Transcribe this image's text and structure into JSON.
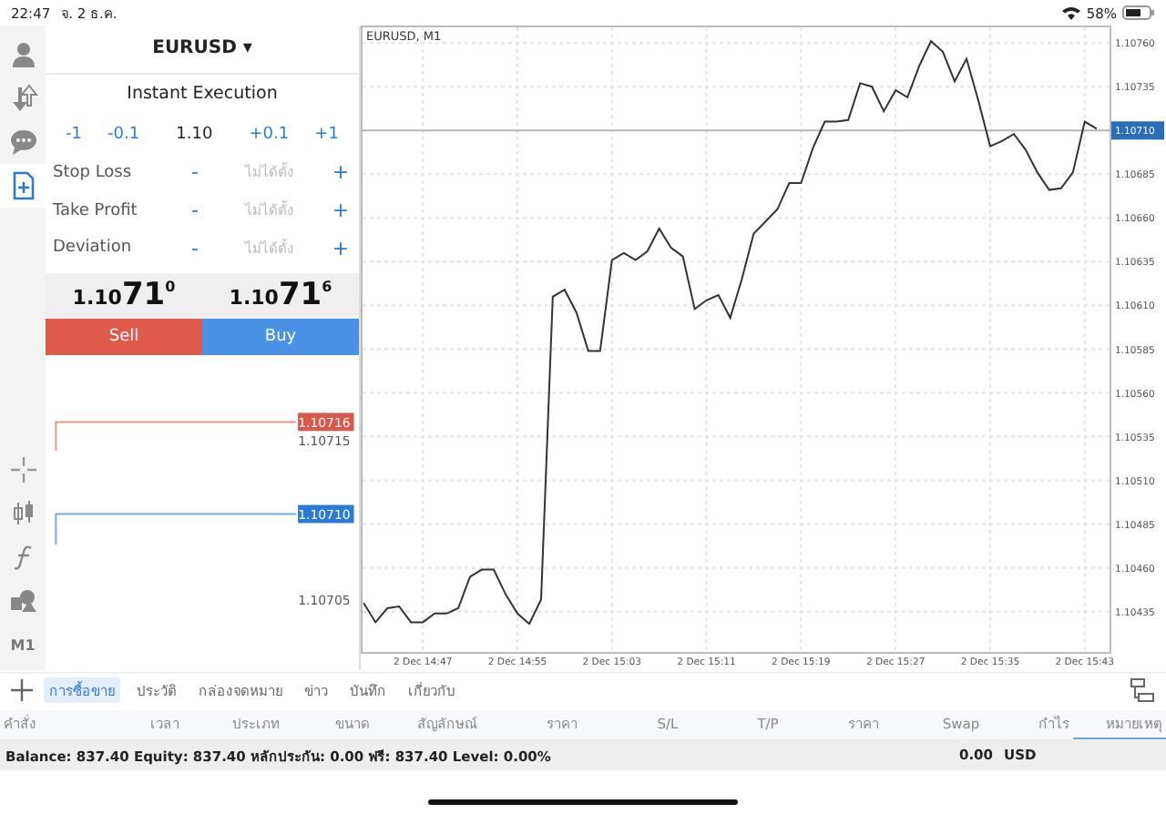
{
  "status_bar": {
    "time": "22:47",
    "date": "จ. 2 ธ.ค.",
    "battery": "58%"
  },
  "rail": {
    "tools": [
      {
        "kind": "person",
        "selected": false
      },
      {
        "kind": "arrows",
        "selected": false
      },
      {
        "kind": "chat",
        "selected": false
      },
      {
        "kind": "order",
        "selected": true
      }
    ],
    "chart_tools": [
      {
        "kind": "crosshair"
      },
      {
        "kind": "candles"
      },
      {
        "kind": "function"
      },
      {
        "kind": "shapes"
      },
      {
        "kind": "timeframe",
        "label": "M1"
      }
    ]
  },
  "order": {
    "symbol": "EURUSD",
    "caret": "▾",
    "mode": "Instant Execution",
    "volume_down": [
      "-1",
      "-0.1"
    ],
    "volume": "1.10",
    "volume_up": [
      "+0.1",
      "+1"
    ],
    "fields": [
      {
        "label": "Stop Loss",
        "minus": "-",
        "placeholder": "ไม่ได้ตั้ง",
        "plus": "+"
      },
      {
        "label": "Take Profit",
        "minus": "-",
        "placeholder": "ไม่ได้ตั้ง",
        "plus": "+"
      },
      {
        "label": "Deviation",
        "minus": "-",
        "placeholder": "ไม่ได้ตั้ง",
        "plus": "+"
      }
    ],
    "bid": {
      "big": "1.10",
      "pips": "71",
      "point": "0"
    },
    "ask": {
      "big": "1.10",
      "pips": "71",
      "point": "6"
    },
    "sell": "Sell",
    "buy": "Buy",
    "ticks": {
      "ask_tag": "1.10716",
      "level_1": "1.10715",
      "bid_tag": "1.10710",
      "level_2": "1.10705"
    }
  },
  "chart": {
    "chart_data": {
      "type": "line",
      "title": "EURUSD, M1",
      "grid": true,
      "ref_lines": [
        {
          "axis": "y",
          "value": 1.1071,
          "label": "1.10710"
        }
      ],
      "categories": [
        null,
        null,
        null,
        null,
        null,
        "2 Dec 14:47",
        null,
        null,
        null,
        null,
        null,
        null,
        null,
        "2 Dec 14:55",
        null,
        null,
        null,
        null,
        null,
        null,
        null,
        "2 Dec 15:03",
        null,
        null,
        null,
        null,
        null,
        null,
        null,
        "2 Dec 15:11",
        null,
        null,
        null,
        null,
        null,
        null,
        null,
        "2 Dec 15:19",
        null,
        null,
        null,
        null,
        null,
        null,
        null,
        "2 Dec 15:27",
        null,
        null,
        null,
        null,
        null,
        null,
        null,
        "2 Dec 15:35",
        null,
        null,
        null,
        null,
        null,
        null,
        null,
        "2 Dec 15:43",
        null
      ],
      "series": [
        {
          "color": "#333333",
          "values": [
            1.1044,
            1.10429,
            1.10437,
            1.10438,
            1.10429,
            1.10429,
            1.10434,
            1.10434,
            1.10437,
            1.10455,
            1.10459,
            1.10459,
            1.10445,
            1.10434,
            1.10428,
            1.10442,
            1.10615,
            1.10619,
            1.10606,
            1.10584,
            1.10584,
            1.10636,
            1.1064,
            1.10636,
            1.10641,
            1.10654,
            1.10643,
            1.10638,
            1.10608,
            1.10613,
            1.10616,
            1.10603,
            1.10625,
            1.10651,
            1.10658,
            1.10665,
            1.1068,
            1.1068,
            1.107,
            1.10715,
            1.10715,
            1.10716,
            1.10737,
            1.10735,
            1.10721,
            1.10733,
            1.10729,
            1.10747,
            1.10761,
            1.10755,
            1.10738,
            1.10751,
            1.10727,
            1.10701,
            1.10704,
            1.10708,
            1.10699,
            1.10686,
            1.10676,
            1.10677,
            1.10686,
            1.10715,
            1.10711
          ]
        }
      ],
      "ylim": [
        1.10412,
        1.1077
      ],
      "yticks": [
        {
          "value": 1.10435,
          "label": "1.10435"
        },
        {
          "value": 1.1046,
          "label": "1.10460"
        },
        {
          "value": 1.10485,
          "label": "1.10485"
        },
        {
          "value": 1.1051,
          "label": "1.10510"
        },
        {
          "value": 1.10535,
          "label": "1.10535"
        },
        {
          "value": 1.1056,
          "label": "1.10560"
        },
        {
          "value": 1.10585,
          "label": "1.10585"
        },
        {
          "value": 1.1061,
          "label": "1.10610"
        },
        {
          "value": 1.10635,
          "label": "1.10635"
        },
        {
          "value": 1.1066,
          "label": "1.10660"
        },
        {
          "value": 1.10685,
          "label": "1.10685"
        },
        {
          "value": 1.10735,
          "label": "1.10735"
        },
        {
          "value": 1.1076,
          "label": "1.10760"
        }
      ]
    }
  },
  "bottom_tabs": [
    {
      "label": "การซื้อขาย",
      "selected": true
    },
    {
      "label": "ประวัติ",
      "selected": false
    },
    {
      "label": "กล่องจดหมาย",
      "selected": false
    },
    {
      "label": "ข่าว",
      "selected": false
    },
    {
      "label": "บันทึก",
      "selected": false
    },
    {
      "label": "เกี่ยวกับ",
      "selected": false
    }
  ],
  "table": {
    "columns": [
      {
        "label": "คำสั่ง",
        "selected": false
      },
      {
        "label": "เวลา",
        "selected": false
      },
      {
        "label": "ประเภท",
        "selected": false
      },
      {
        "label": "ขนาด",
        "selected": false
      },
      {
        "label": "สัญลักษณ์",
        "selected": false
      },
      {
        "label": "ราคา",
        "selected": false
      },
      {
        "label": "S/L",
        "selected": false
      },
      {
        "label": "T/P",
        "selected": false
      },
      {
        "label": "ราคา",
        "selected": false
      },
      {
        "label": "Swap",
        "selected": false
      },
      {
        "label": "กำไร",
        "selected": false
      },
      {
        "label": "หมายเหตุ",
        "selected": true
      }
    ]
  },
  "balance": {
    "summary": "Balance: 837.40 Equity: 837.40 หลักประกัน: 0.00 ฟรี: 837.40 Level: 0.00%",
    "profit": "0.00",
    "currency": "USD"
  }
}
